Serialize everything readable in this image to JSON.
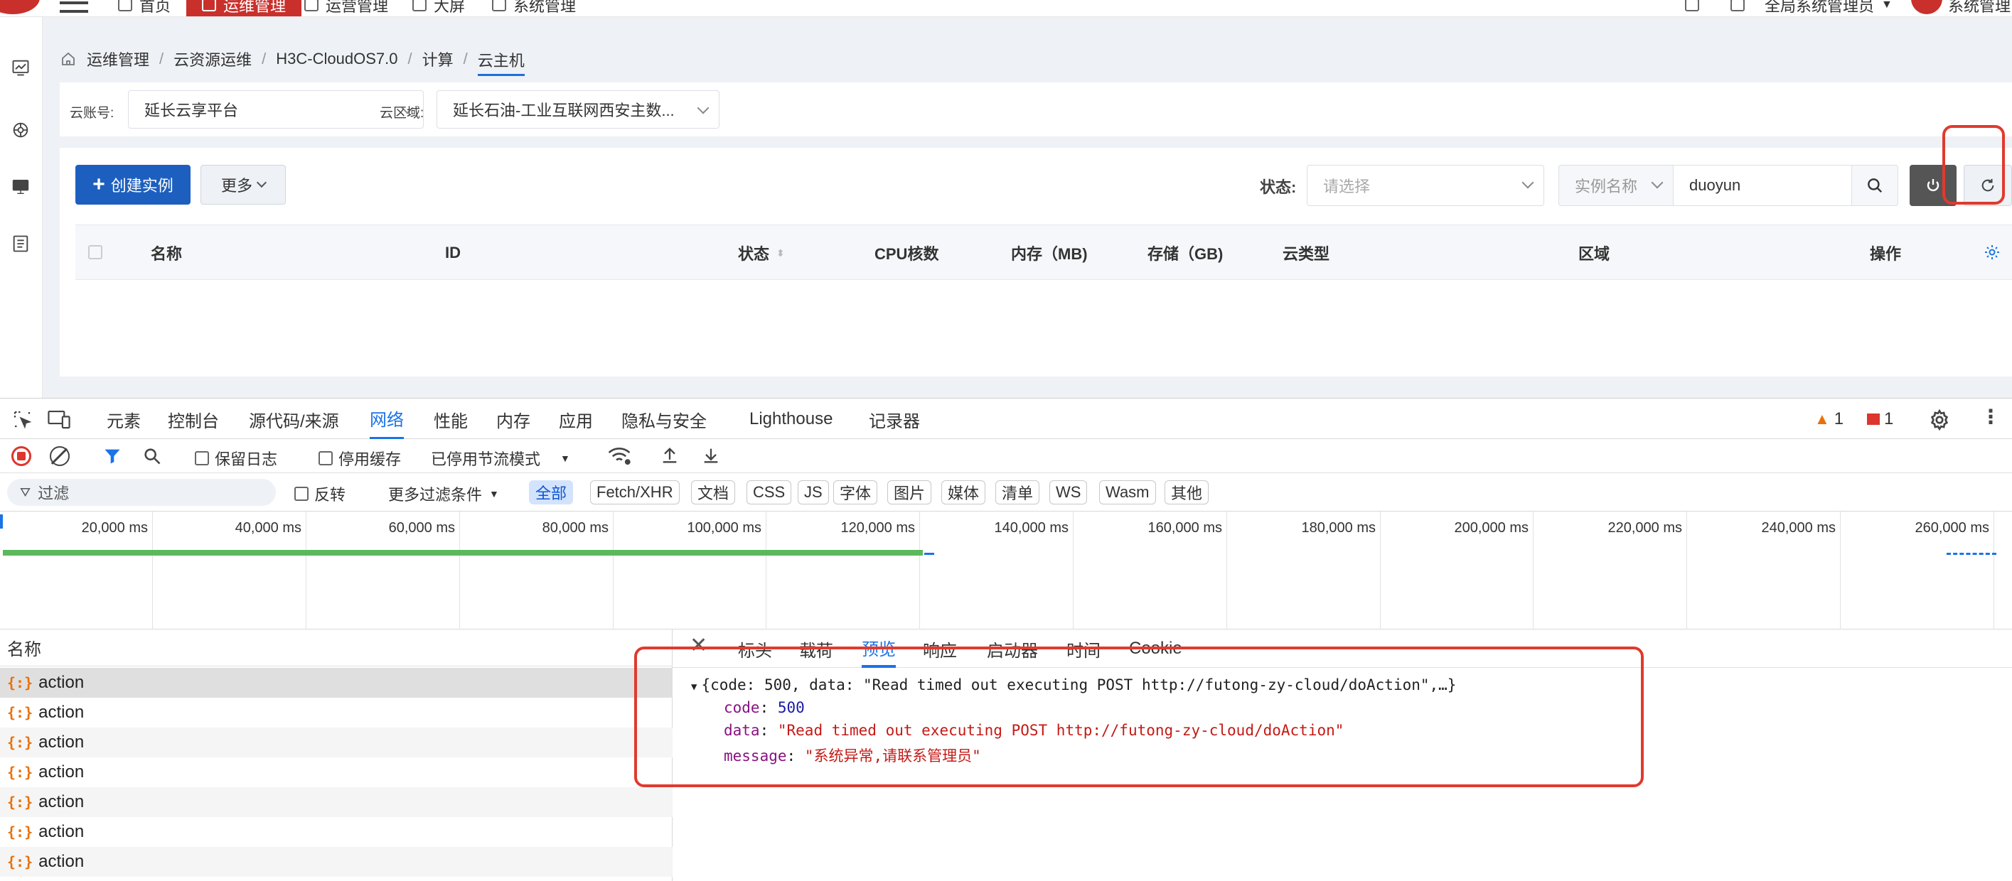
{
  "topnav": {
    "items": [
      "首页",
      "运维管理",
      "运营管理",
      "大屏",
      "系统管理"
    ],
    "user_role": "全局系统管理员",
    "user_name": "系统管理"
  },
  "breadcrumb": [
    "运维管理",
    "云资源运维",
    "H3C-CloudOS7.0",
    "计算",
    "云主机"
  ],
  "filters": {
    "account_label": "云账号:",
    "account_value": "延长云享平台",
    "region_label": "云区域:",
    "region_value": "延长石油-工业互联网西安主数..."
  },
  "toolbar": {
    "create_label": "创建实例",
    "more_label": "更多",
    "status_label": "状态:",
    "status_placeholder": "请选择",
    "search_field": "实例名称",
    "search_value": "duoyun"
  },
  "table": {
    "columns": [
      "名称",
      "ID",
      "状态",
      "CPU核数",
      "内存（MB)",
      "存储（GB)",
      "云类型",
      "区域",
      "操作"
    ]
  },
  "devtools": {
    "tabs": [
      "元素",
      "控制台",
      "源代码/来源",
      "网络",
      "性能",
      "内存",
      "应用",
      "隐私与安全",
      "Lighthouse",
      "记录器"
    ],
    "warnings": "1",
    "errors": "1",
    "toolbar": {
      "preserve_log": "保留日志",
      "disable_cache": "停用缓存",
      "throttle": "已停用节流模式"
    },
    "filter": {
      "placeholder": "过滤",
      "invert": "反转",
      "more_filters": "更多过滤条件",
      "types": [
        "全部",
        "Fetch/XHR",
        "文档",
        "CSS",
        "JS",
        "字体",
        "图片",
        "媒体",
        "清单",
        "WS",
        "Wasm",
        "其他"
      ]
    },
    "timeline_ticks": [
      "20,000 ms",
      "40,000 ms",
      "60,000 ms",
      "80,000 ms",
      "100,000 ms",
      "120,000 ms",
      "140,000 ms",
      "160,000 ms",
      "180,000 ms",
      "200,000 ms",
      "220,000 ms",
      "240,000 ms",
      "260,000 ms"
    ],
    "list_header": "名称",
    "requests": [
      "action",
      "action",
      "action",
      "action",
      "action",
      "action",
      "action"
    ],
    "detail_tabs": [
      "标头",
      "载荷",
      "预览",
      "响应",
      "启动器",
      "时间",
      "Cookie"
    ],
    "preview": {
      "summary": "{code: 500, data: \"Read timed out executing POST http://futong-zy-cloud/doAction\",…}",
      "code_key": "code",
      "code_value": "500",
      "data_key": "data",
      "data_value": "\"Read timed out executing POST http://futong-zy-cloud/doAction\"",
      "message_key": "message",
      "message_value": "\"系统异常,请联系管理员\""
    }
  },
  "colors": {
    "brand_red": "#c9302c",
    "primary_blue": "#1d5fbf",
    "devtools_blue": "#1a73e8",
    "highlight_red": "#e03a2e"
  }
}
